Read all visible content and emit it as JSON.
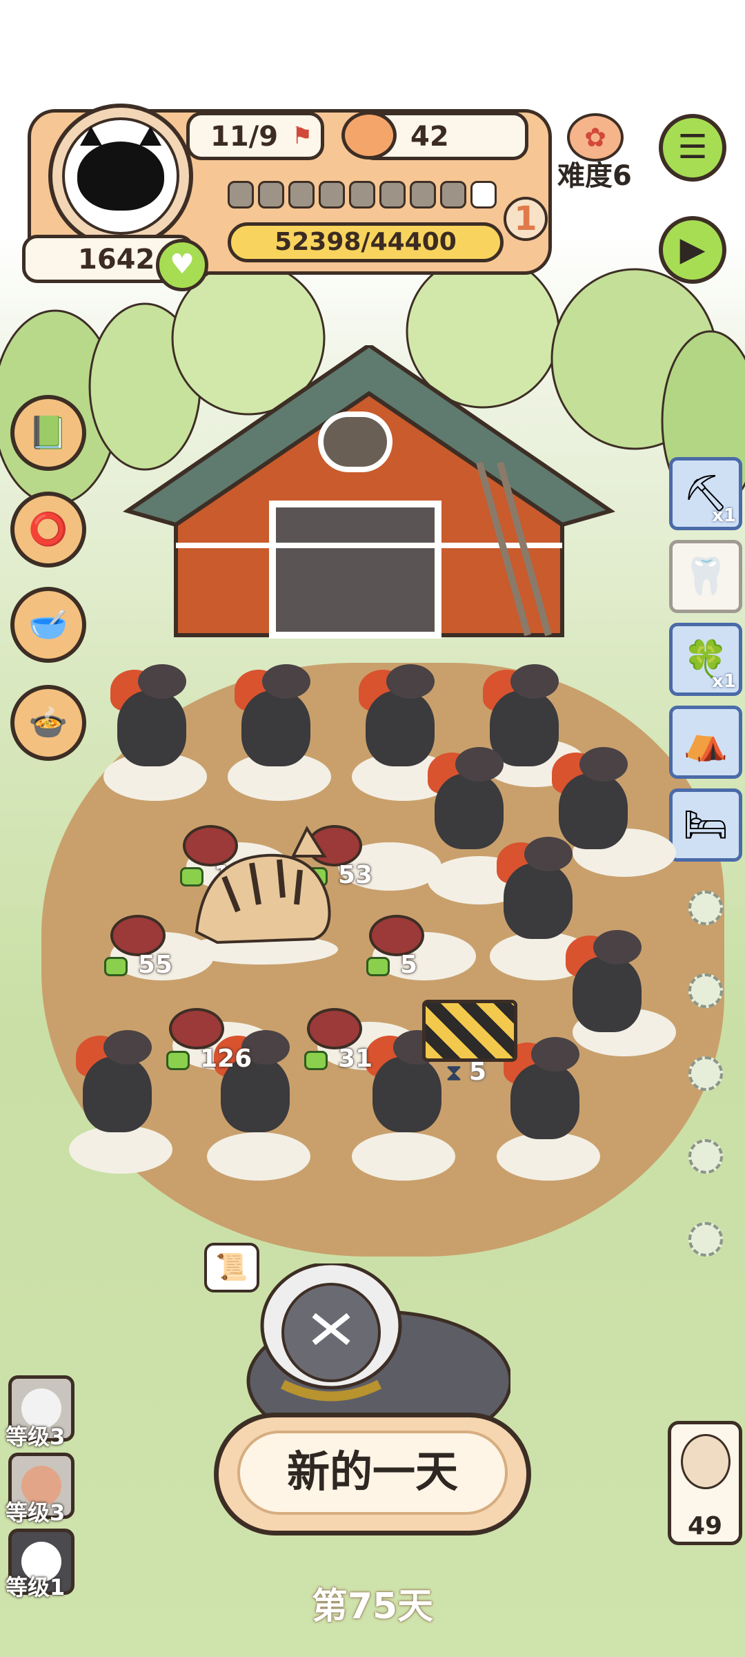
{
  "hud": {
    "progress_text": "11/9",
    "coins": "42",
    "score": "1642",
    "xp_text": "52398/44400",
    "level": "1",
    "segments_filled": 8,
    "segments_total": 9
  },
  "difficulty": {
    "label": "难度6"
  },
  "left_buttons": [
    "book-icon",
    "collar-icon",
    "pet-bowl-icon",
    "food-bowl-icon"
  ],
  "right_slots": [
    {
      "icon": "shovel-icon",
      "badge": "x1"
    },
    {
      "icon": "claw-icon",
      "badge": ""
    },
    {
      "icon": "charm-icon",
      "badge": "x1"
    },
    {
      "icon": "shelter-icon",
      "badge": ""
    },
    {
      "icon": "pet-bed-icon",
      "badge": ""
    }
  ],
  "meat_counts": [
    "13",
    "53",
    "55",
    "5",
    "126",
    "31"
  ],
  "timer_count": "5",
  "levels": [
    {
      "label": "等级3"
    },
    {
      "label": "等级3"
    },
    {
      "label": "等级1"
    }
  ],
  "owl_count": "49",
  "new_day_label": "新的一天",
  "day_label": "第75天",
  "colors": {
    "accent_green": "#a7dd53",
    "panel_orange": "#f6c694",
    "outline": "#3d2e25",
    "xp_yellow": "#f8d45e"
  }
}
